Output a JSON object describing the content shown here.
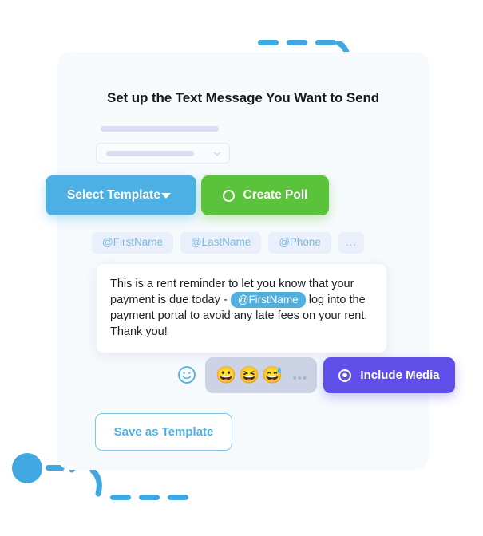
{
  "page": {
    "background": "#ffffff",
    "card_background": "#f7fafd"
  },
  "card": {
    "title": "Set up the Text Message You Want to Send"
  },
  "template_select": {
    "icon": "chevron-down-icon",
    "value": "",
    "placeholder": ""
  },
  "actions": {
    "select_template_label": "Select Template",
    "select_template_caret_icon": "caret-down-icon",
    "select_template_color": "#4cb0e4",
    "create_poll_label": "Create Poll",
    "create_poll_icon": "circle-icon",
    "create_poll_color": "#5ac23b",
    "include_media_label": "Include Media",
    "include_media_icon": "target-circle-icon",
    "include_media_color": "#5f4ee8",
    "save_template_label": "Save as Template",
    "save_template_color": "#4cb0e4"
  },
  "variable_tags": [
    {
      "label": "@FirstName"
    },
    {
      "label": "@LastName"
    },
    {
      "label": "@Phone"
    },
    {
      "label": "..."
    }
  ],
  "message": {
    "part1": "This is a rent reminder to let you know that your payment is due today - ",
    "variable": "@FirstName",
    "part2": " log into the payment portal to avoid any late fees on your rent. Thank you!",
    "variable_color": "#4fb0e0"
  },
  "emoji_bar": {
    "face_icon": "smiley-face-icon",
    "emojis": [
      "😀",
      "😆",
      "😅"
    ],
    "more_label": "•••",
    "strip_color": "#ccd3e4"
  },
  "decoration": {
    "accent_color": "#41a7e0",
    "halo_color": "#d9ecf9"
  }
}
